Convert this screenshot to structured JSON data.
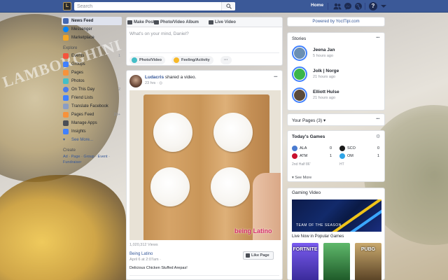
{
  "topbar": {
    "search_placeholder": "Search",
    "home_label": "Home",
    "help_label": "?"
  },
  "logo_text": "L",
  "left_nav": {
    "top_items": [
      {
        "label": "News Feed",
        "active": true,
        "icon": "news-feed-icon",
        "color": "#4267b2"
      },
      {
        "label": "Messenger",
        "icon": "messenger-icon",
        "color": "#0084ff"
      },
      {
        "label": "Marketplace",
        "icon": "marketplace-icon",
        "color": "#f5a623"
      }
    ],
    "explore_heading": "Explore",
    "explore_items": [
      {
        "label": "Events",
        "count": "1",
        "icon": "events-icon",
        "color": "#f5533d"
      },
      {
        "label": "Groups",
        "icon": "groups-icon",
        "color": "#4080ff"
      },
      {
        "label": "Pages",
        "icon": "pages-icon",
        "color": "#f7923b"
      },
      {
        "label": "Photos",
        "icon": "photos-icon",
        "color": "#44bec7"
      },
      {
        "label": "On This Day",
        "count": "2",
        "icon": "on-this-day-icon",
        "color": "#4b7bec"
      },
      {
        "label": "Friend Lists",
        "icon": "friend-lists-icon",
        "color": "#4080ff"
      },
      {
        "label": "Translate Facebook",
        "icon": "translate-icon",
        "color": "#8b9dc3"
      },
      {
        "label": "Pages Feed",
        "count": "20+",
        "icon": "pages-feed-icon",
        "color": "#f7923b"
      },
      {
        "label": "Manage Apps",
        "icon": "manage-apps-icon",
        "color": "#4b4f56"
      },
      {
        "label": "Insights",
        "icon": "insights-icon",
        "color": "#4080ff"
      },
      {
        "label": "See More...",
        "icon": "chevron-down-icon",
        "color": "#365899"
      }
    ],
    "create_heading": "Create",
    "create_links": "Ad · Page · Group · Event · Fundraiser"
  },
  "composer": {
    "tabs": [
      {
        "label": "Make Post",
        "icon": "pencil-icon",
        "color": "#4b4f56"
      },
      {
        "label": "Photo/Video Album",
        "icon": "album-icon",
        "color": "#4b4f56"
      },
      {
        "label": "Live Video",
        "icon": "live-video-icon",
        "color": "#4b4f56"
      }
    ],
    "placeholder": "What's on your mind, Daniel?",
    "buttons": [
      {
        "label": "Photo/Video",
        "color": "#44bec7"
      },
      {
        "label": "Feeling/Activity",
        "color": "#f7b928"
      }
    ],
    "more": "···"
  },
  "post": {
    "author": "Ludacris",
    "action": " shared a video.",
    "time": "23 hrs · ",
    "globe": "◎",
    "more": "···",
    "watermark": "being Latino",
    "views": "1,020,312 Views",
    "page_name": "Being Latino",
    "page_date": "April 6 at 2:07am · ",
    "like_page": "Like Page",
    "description": "Delicious Chicken Stuffed Arepas!"
  },
  "right": {
    "powered": "Powered by YoctTipi.com",
    "stories_heading": "Stories",
    "stories_more": "···",
    "stories": [
      {
        "name": "Jeena Jan",
        "time": "5 hours ago",
        "color": "#6b8fb3"
      },
      {
        "name": "Jolk | Norge",
        "time": "21 hours ago",
        "color": "#3ab54a"
      },
      {
        "name": "Elliott Hulse",
        "time": "21 hours ago",
        "color": "#5a4a3a"
      }
    ],
    "your_pages": "Your Pages (3)",
    "your_pages_arrow": "▾",
    "your_pages_more": "···",
    "games_heading": "Today's Games",
    "games_gear": "⚙",
    "game1": {
      "team1": "ALA",
      "score1": "0",
      "team2": "ATM",
      "score2": "1",
      "note": "2nd Half 86'",
      "color1": "#4a7bd0",
      "color2": "#c8102e"
    },
    "game2": {
      "team1": "SCO",
      "score1": "0",
      "team2": "OM",
      "score2": "1",
      "note": "HT",
      "color1": "#1a1a1a",
      "color2": "#2fa4e7"
    },
    "games_see_more": "See More",
    "gaming_heading": "Gaming Video",
    "gaming_video_text": "TEAM OF THE SEASON",
    "live_now": "Live Now in Popular Games",
    "live_games": [
      {
        "title": "FORTNITE",
        "color": "#5b3ec8"
      },
      {
        "title": "",
        "color": "#2e8a3a"
      },
      {
        "title": "PUBG",
        "color": "#a2865a"
      }
    ]
  }
}
